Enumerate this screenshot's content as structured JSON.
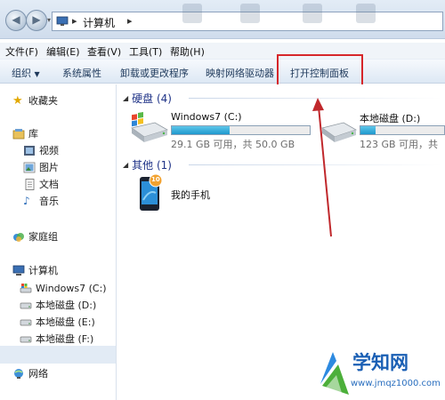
{
  "address": {
    "location": "计算机"
  },
  "menu": [
    "文件(F)",
    "编辑(E)",
    "查看(V)",
    "工具(T)",
    "帮助(H)"
  ],
  "toolbar": {
    "organize": "组织",
    "system_properties": "系统属性",
    "uninstall": "卸载或更改程序",
    "map_drive": "映射网络驱动器",
    "open_control_panel": "打开控制面板"
  },
  "nav": {
    "favorites": "收藏夹",
    "libraries": "库",
    "videos": "视频",
    "pictures": "图片",
    "documents": "文档",
    "music": "音乐",
    "homegroup": "家庭组",
    "computer": "计算机",
    "drive_c": "Windows7 (C:)",
    "drive_d": "本地磁盘 (D:)",
    "drive_e": "本地磁盘 (E:)",
    "drive_f": "本地磁盘 (F:)",
    "network": "网络"
  },
  "content": {
    "hard_drives_header": "硬盘 (4)",
    "other_header": "其他 (1)",
    "drives": [
      {
        "name": "Windows7 (C:)",
        "free": "29.1 GB 可用，共 50.0 GB",
        "used_fraction": 0.418
      },
      {
        "name": "本地磁盘 (D:)",
        "free": "123 GB 可用，共",
        "used_fraction": 0.18
      }
    ],
    "phone": "我的手机",
    "phone_badge": "10"
  },
  "watermark": {
    "title": "学知网",
    "url": "www.jmqz1000.com"
  },
  "colors": {
    "highlight_box": "#d6262a",
    "arrow": "#c0282c",
    "drive_fill": "#26a0d2",
    "header_text": "#1e3287"
  }
}
